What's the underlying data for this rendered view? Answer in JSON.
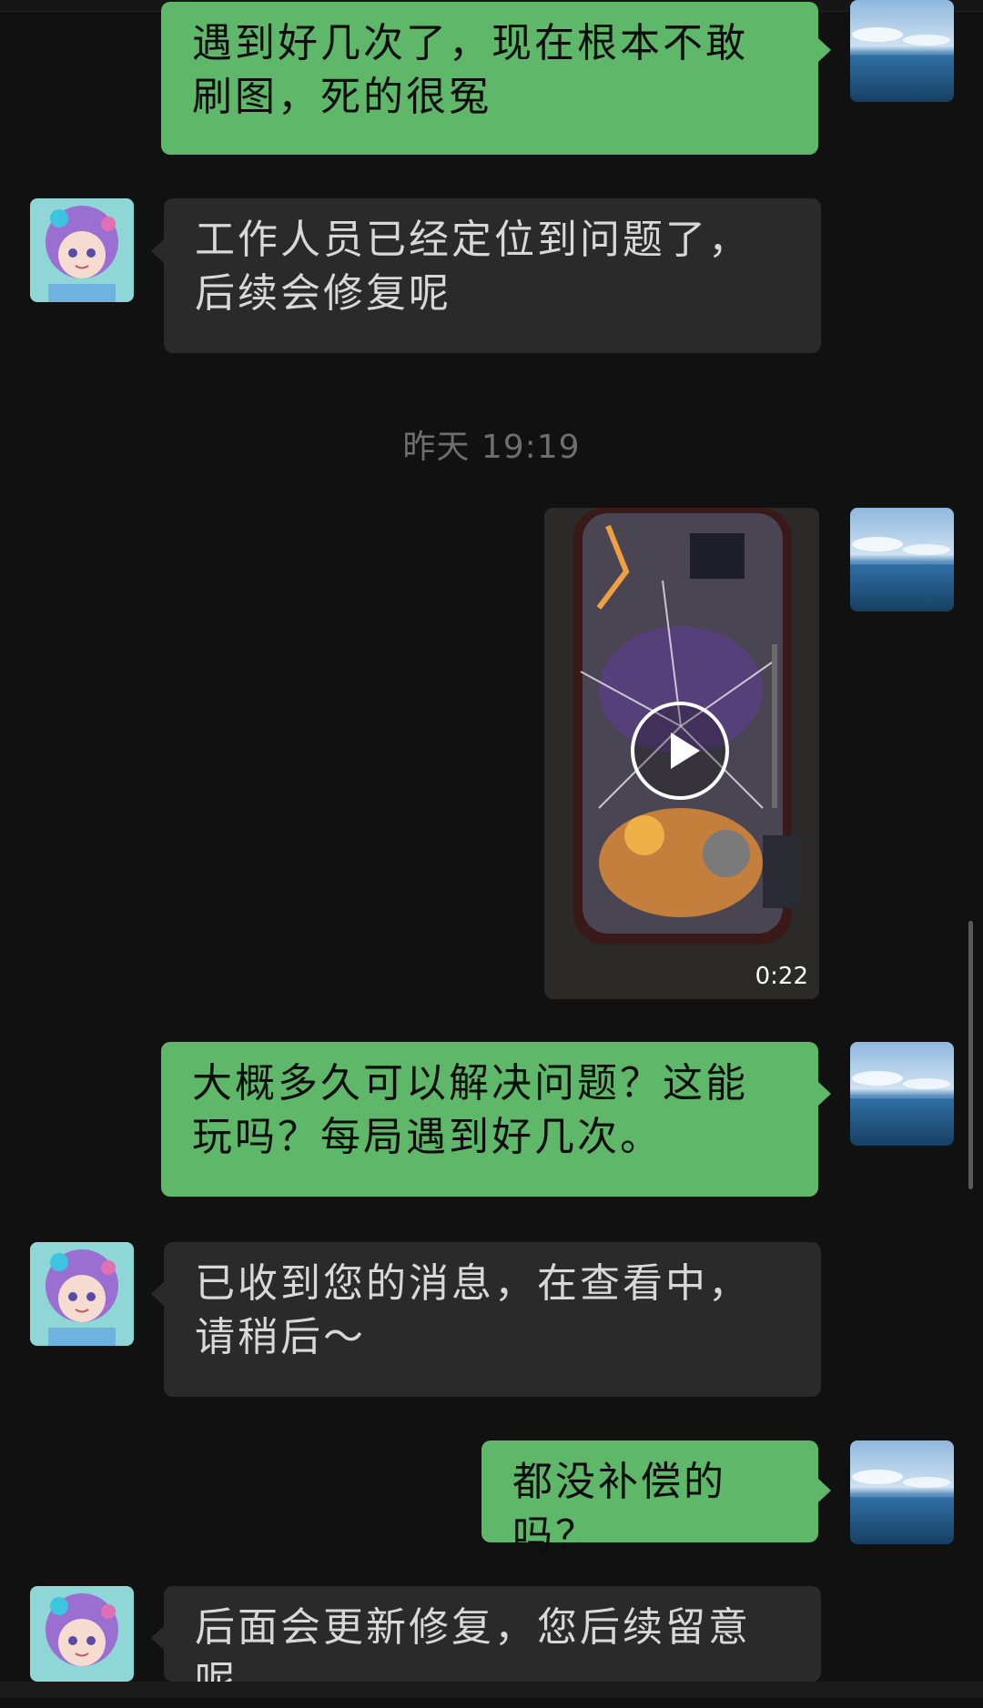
{
  "chat": {
    "messages": [
      {
        "sender": "self",
        "type": "text",
        "text": "遇到好几次了，现在根本不敢刷图，死的很冤"
      },
      {
        "sender": "other",
        "type": "text",
        "text": "工作人员已经定位到问题了，后续会修复呢"
      },
      {
        "type": "timestamp",
        "text": "昨天 19:19"
      },
      {
        "sender": "self",
        "type": "video",
        "duration": "0:22"
      },
      {
        "sender": "self",
        "type": "text",
        "text": "大概多久可以解决问题？这能玩吗？每局遇到好几次。"
      },
      {
        "sender": "other",
        "type": "text",
        "text": "已收到您的消息，在查看中，请稍后～"
      },
      {
        "sender": "self",
        "type": "text",
        "text": "都没补偿的吗？"
      },
      {
        "sender": "other",
        "type": "text",
        "text": "后面会更新修复，您后续留意呢"
      }
    ]
  },
  "colors": {
    "background": "#111111",
    "self_bubble": "#5fb86a",
    "other_bubble": "#2a2a2a",
    "timestamp": "#6e6e6e"
  },
  "icons": {
    "self_avatar": "ocean-sky-avatar",
    "other_avatar": "anime-girl-avatar",
    "video_play": "play-icon"
  }
}
